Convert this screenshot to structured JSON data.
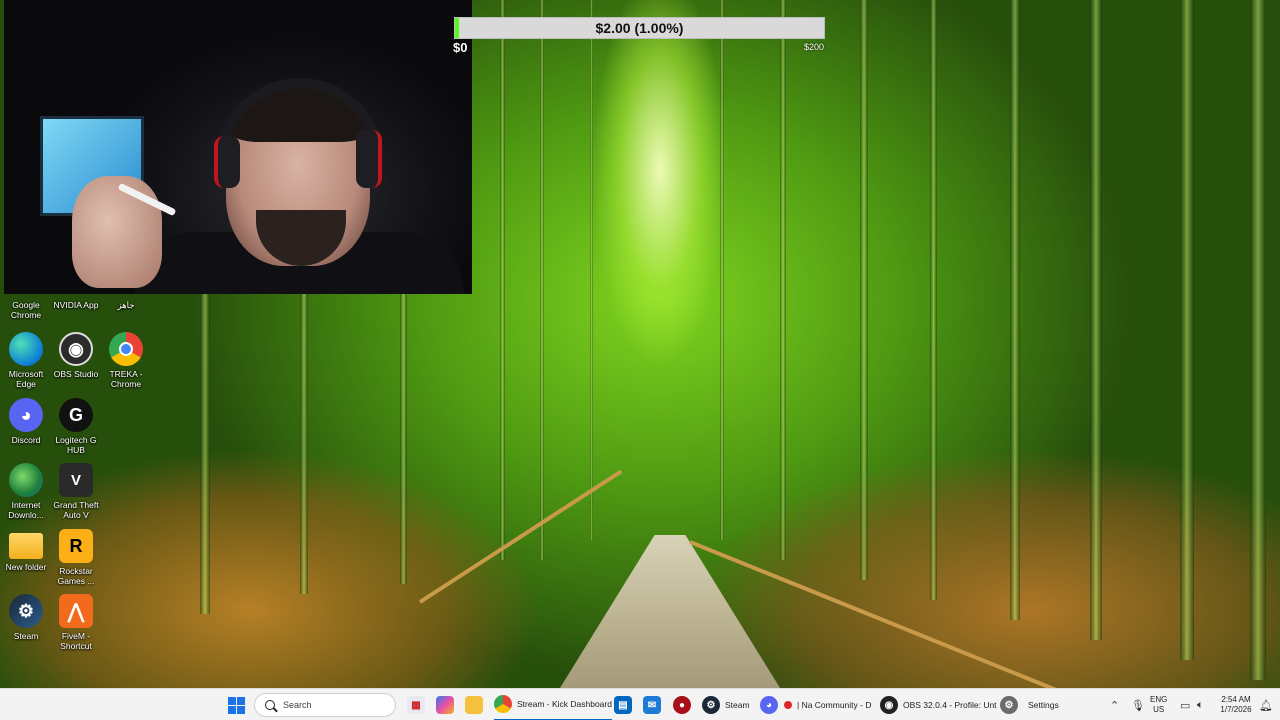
{
  "goal": {
    "label": "$2.00 (1.00%)",
    "min_label": "$0",
    "max_label": "$200",
    "progress_fraction": 0.01,
    "fill_color": "#53fc18"
  },
  "desktop": {
    "icons": [
      {
        "label": "Google Chrome",
        "icon": "chrome-icon"
      },
      {
        "label": "NVIDIA App",
        "icon": "nvidia-icon"
      },
      {
        "label": "جاهز",
        "icon": "shortcut-icon"
      },
      {
        "label": "Microsoft Edge",
        "icon": "edge-icon"
      },
      {
        "label": "OBS Studio",
        "icon": "obs-icon"
      },
      {
        "label": "TREKA - Chrome",
        "icon": "chrome-icon"
      },
      {
        "label": "Discord",
        "icon": "discord-icon"
      },
      {
        "label": "Logitech G HUB",
        "icon": "logitech-icon"
      },
      {
        "label": "Internet Downlo...",
        "icon": "idm-icon"
      },
      {
        "label": "Grand Theft Auto V",
        "icon": "gta-icon"
      },
      {
        "label": "New folder",
        "icon": "folder-icon"
      },
      {
        "label": "Rockstar Games ...",
        "icon": "rockstar-icon"
      },
      {
        "label": "Steam",
        "icon": "steam-icon"
      },
      {
        "label": "FiveM - Shortcut",
        "icon": "fivem-icon"
      }
    ]
  },
  "taskbar": {
    "search_placeholder": "Search",
    "apps": [
      {
        "label": "Stream - Kick Dashboard",
        "icon": "chrome-icon"
      },
      {
        "label": "Steam",
        "icon": "steam-icon"
      },
      {
        "label": "| Na Community - D",
        "icon": "discord-icon"
      },
      {
        "label": "OBS 32.0.4 - Profile: Unt",
        "icon": "obs-icon"
      },
      {
        "label": "Settings",
        "icon": "settings-icon"
      }
    ],
    "tray": {
      "language": "ENG",
      "region": "US",
      "time": "2:54 AM",
      "date": "1/7/2026"
    }
  }
}
